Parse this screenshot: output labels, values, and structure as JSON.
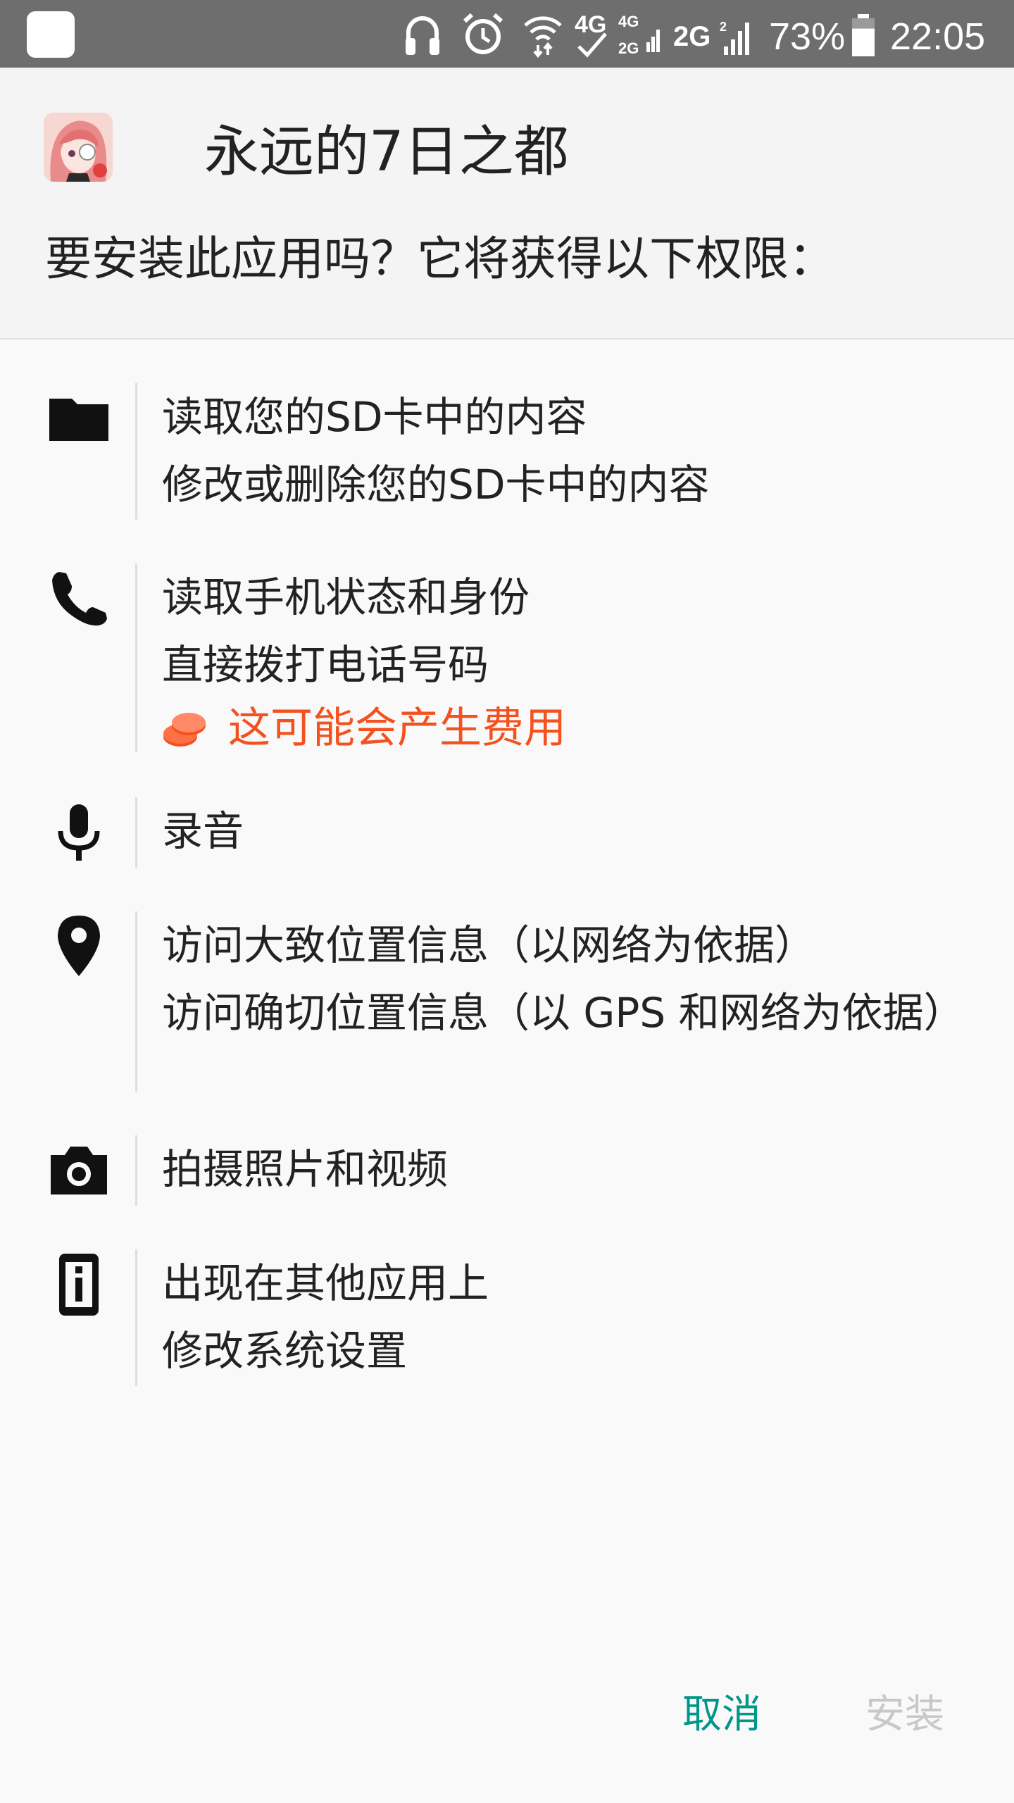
{
  "status_bar": {
    "icons": [
      "app-notification-icon",
      "headphones-icon",
      "alarm-icon",
      "wifi-icon",
      "signal-4g-icon",
      "signal-2g-icon",
      "battery-icon"
    ],
    "net_4g": "4G",
    "net_2g": "2G",
    "battery_percent": "73%",
    "battery_level": 0.73,
    "time": "22:05"
  },
  "header": {
    "app_icon": "anime-character-app-icon",
    "app_name": "永远的7日之都",
    "question": "要安装此应用吗？它将获得以下权限："
  },
  "permissions": [
    {
      "icon": "folder-icon",
      "lines": [
        "读取您的SD卡中的内容",
        "修改或删除您的SD卡中的内容"
      ]
    },
    {
      "icon": "phone-icon",
      "lines": [
        "读取手机状态和身份",
        "直接拨打电话号码"
      ],
      "cost_warning": "这可能会产生费用",
      "cost_icon": "coins-icon"
    },
    {
      "icon": "microphone-icon",
      "lines": [
        "录音"
      ]
    },
    {
      "icon": "location-pin-icon",
      "lines": [
        "访问大致位置信息（以网络为依据）",
        "访问确切位置信息（以 GPS 和网络为依据）"
      ]
    },
    {
      "icon": "camera-icon",
      "lines": [
        "拍摄照片和视频"
      ]
    },
    {
      "icon": "info-device-icon",
      "lines": [
        "出现在其他应用上",
        "修改系统设置"
      ]
    }
  ],
  "buttons": {
    "cancel": "取消",
    "install": "安装"
  },
  "colors": {
    "accent": "#009688",
    "disabled": "#c8c8c8",
    "warning": "#f4511e",
    "status_bar": "#6e6e6e"
  }
}
